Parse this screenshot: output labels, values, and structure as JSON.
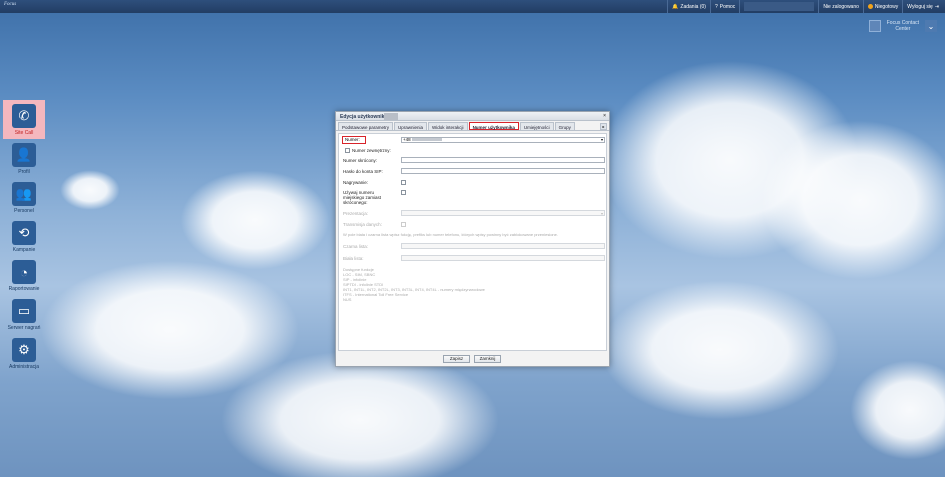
{
  "topbar": {
    "logo": "Focus",
    "notifications_label": "Zadania (0)",
    "help_label": "Pomoc",
    "status_label": "Nie zalogowano",
    "availability_label": "Niegotowy",
    "logout_label": "Wyloguj się"
  },
  "brand": {
    "line1": "Focus Contact",
    "line2": "Center"
  },
  "sidebar": {
    "items": [
      {
        "label": "Site Call",
        "icon": "phone-icon",
        "glyph": "✆"
      },
      {
        "label": "Profil",
        "icon": "user-icon",
        "glyph": "👤"
      },
      {
        "label": "Personel",
        "icon": "users-icon",
        "glyph": "👥"
      },
      {
        "label": "Kampanie",
        "icon": "campaign-icon",
        "glyph": "⟲"
      },
      {
        "label": "Raportowanie",
        "icon": "pie-chart-icon",
        "glyph": "◔"
      },
      {
        "label": "Serwer nagrań",
        "icon": "recording-server-icon",
        "glyph": "▭"
      },
      {
        "label": "Administracja",
        "icon": "gear-icon",
        "glyph": "⚙"
      }
    ]
  },
  "dialog": {
    "title": "Edycja użytkownika",
    "tabs": [
      "Podstawowe parametry",
      "Uprawnienia",
      "Widok interakcji",
      "Numer użytkownika",
      "Umiejętności",
      "Grupy"
    ],
    "active_tab": "Numer użytkownika",
    "fields": {
      "numer_label": "Numer:",
      "numer_value": "+48",
      "numer_zewnetrzny": "Numer zewnętrzny:",
      "numer_skrocony": "Numer skrócony:",
      "haslo_sip": "Hasło do konta SIP:",
      "nagrywanie": "Nagrywanie:",
      "uzywaj_line1": "Używaj numeru",
      "uzywaj_line2": "miejskiego zamiast",
      "uzywaj_line3": "skróconego:",
      "prezentacja": "Prezentacja:",
      "transmisja": "Transmisja danych:",
      "info": "W pole biała i czarna lista wpisz fukcję, prefiks lub numer telefonu, których wpisy powinny być zablokowane przeniesione.",
      "czarna_lista": "Czarna lista:",
      "biala_lista": "Biała lista:",
      "dostepne_title": "Dostępne funkcje",
      "dostepne_lines": [
        "LOC - SIM, SBNC",
        "SIP - infolinie",
        "SIPTDI - infolinie STDI",
        "INT1, INT1L, INT2, INT2L, INT3, INT3L, INT4, INT4L - numery międzynarodowe",
        "ITFS - International Toll Free Service",
        "NUS"
      ]
    },
    "buttons": {
      "save": "Zapisz",
      "cancel": "Zamknij"
    }
  }
}
